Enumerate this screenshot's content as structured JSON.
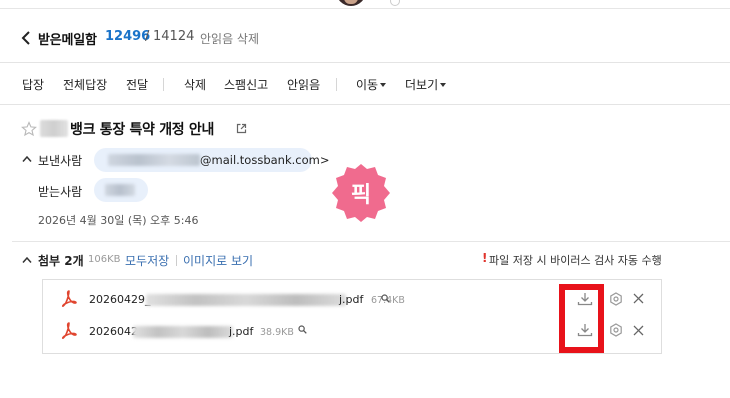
{
  "header": {
    "folder_name": "받은메일함",
    "unread_count": "12496",
    "separator": "/",
    "total_count": "14124",
    "delete_unread": "안읽음 삭제"
  },
  "toolbar": {
    "reply": "답장",
    "reply_all": "전체답장",
    "forward": "전달",
    "delete": "삭제",
    "spam": "스팸신고",
    "mark_unread": "안읽음",
    "move": "이동",
    "more": "더보기"
  },
  "message": {
    "subject": "뱅크 통장 특약 개정 안내",
    "sender_label": "보낸사람",
    "sender_email_visible": "@mail.tossbank.com>",
    "recipient_label": "받는사람",
    "date": "2026년 4월 30일 (목) 오후 5:46",
    "stamp_text": "픽"
  },
  "attachments": {
    "title": "첨부 2개",
    "total_size": "106KB",
    "save_all": "모두저장",
    "view_as_image": "이미지로 보기",
    "warning_mark": "!",
    "warning_text": "파일 저장 시 바이러스 검사 자동 수행",
    "files": [
      {
        "name_prefix": "20260429_",
        "name_suffix": "j.pdf",
        "size": "67.4KB"
      },
      {
        "name_prefix": "2026042",
        "name_suffix": "j.pdf",
        "size": "38.9KB"
      }
    ]
  },
  "colors": {
    "accent_blue": "#1a73c9",
    "link_blue": "#3a6fb0",
    "pill_bg": "#e8f0fb",
    "stamp_pink": "#f06b8e",
    "highlight_red": "#e8121a",
    "pdf_red": "#e0452f"
  },
  "icons": {
    "back": "chevron-left-icon",
    "star": "star-outline-icon",
    "external": "external-link-icon",
    "collapse": "chevron-up-icon",
    "file": "pdf-icon",
    "preview": "magnifier-icon",
    "download": "download-icon",
    "settings": "gear-icon",
    "remove": "close-icon"
  }
}
